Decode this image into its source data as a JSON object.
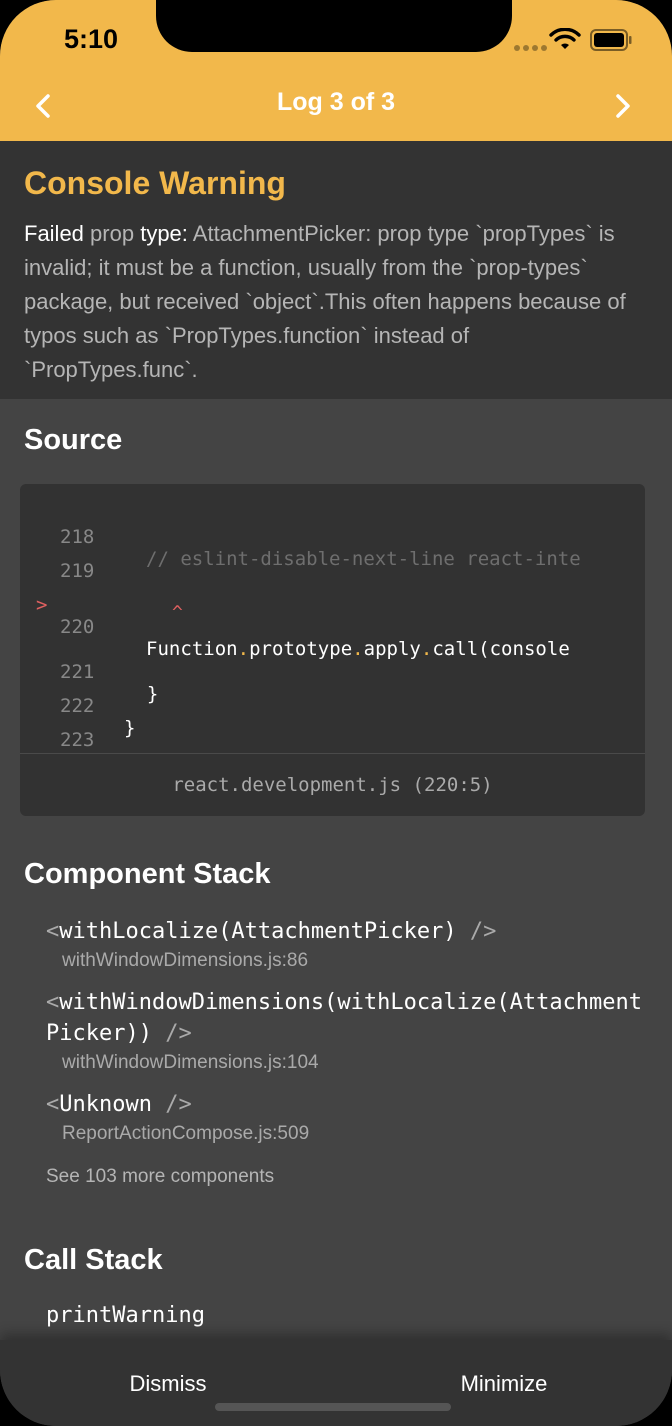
{
  "status_bar": {
    "time": "5:10"
  },
  "header": {
    "title": "Log 3 of 3",
    "color": "#f2b84b"
  },
  "warning": {
    "title": "Console Warning",
    "parts": [
      {
        "text": "Failed ",
        "hl": true
      },
      {
        "text": "prop ",
        "hl": false
      },
      {
        "text": "type: ",
        "hl": true
      },
      {
        "text": "AttachmentPicker: prop type `propTypes` is invalid; it must be a function, usually from the `prop-types` package, but received `object`.This often happens because of typos such as `PropTypes.function` instead of `PropTypes.func`.",
        "hl": false
      }
    ]
  },
  "source": {
    "title": "Source",
    "lines": [
      {
        "num": "218",
        "text": "// eslint-disable-next-line react-inte",
        "kind": "comment",
        "active": false
      },
      {
        "num": "219",
        "text": "",
        "kind": "code",
        "active": false
      },
      {
        "num": "220",
        "text": "Function.prototype.apply.call(console",
        "kind": "code",
        "active": true
      },
      {
        "num": "221",
        "text": "  }",
        "kind": "code",
        "active": false,
        "indent": -1
      },
      {
        "num": "222",
        "text": "}",
        "kind": "code",
        "active": false,
        "indent": -2
      },
      {
        "num": "223",
        "text": "",
        "kind": "code",
        "active": false
      }
    ],
    "marker": ">",
    "caret": "^",
    "file": "react.development.js (220:5)"
  },
  "component_stack": {
    "title": "Component Stack",
    "frames": [
      {
        "name": "withLocalize(AttachmentPicker)",
        "file": "withWindowDimensions.js:86"
      },
      {
        "name": "withWindowDimensions(withLocalize(AttachmentPicker))",
        "file": "withWindowDimensions.js:104"
      },
      {
        "name": "Unknown",
        "file": "ReportActionCompose.js:509"
      }
    ],
    "see_more": "See 103 more components"
  },
  "call_stack": {
    "title": "Call Stack",
    "frames": [
      {
        "name": "printWarning"
      }
    ]
  },
  "buttons": {
    "dismiss": "Dismiss",
    "minimize": "Minimize"
  }
}
